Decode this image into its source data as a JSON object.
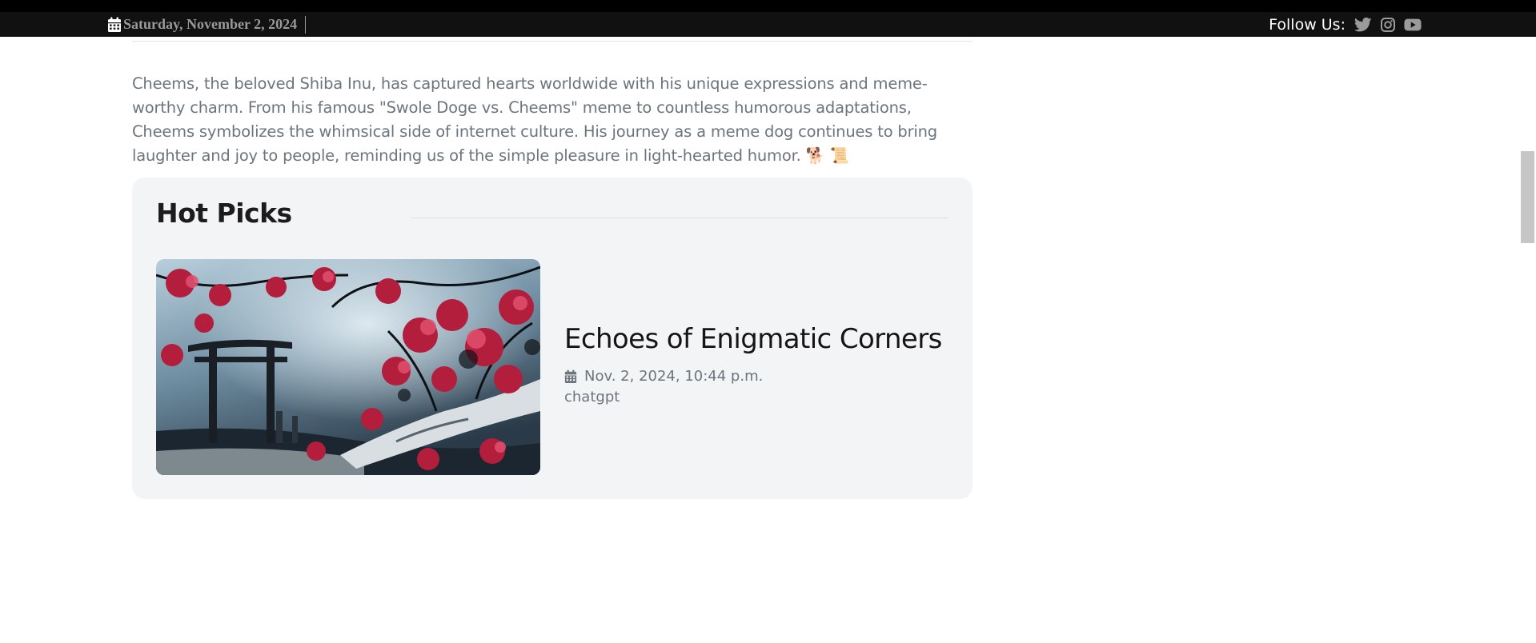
{
  "topbar": {
    "date": "Saturday, November 2, 2024",
    "date_icon": "calendar-icon",
    "follow_label": "Follow Us:",
    "social": [
      {
        "name": "twitter-icon"
      },
      {
        "name": "instagram-icon"
      },
      {
        "name": "youtube-icon"
      }
    ]
  },
  "article": {
    "paragraph": "Cheems, the beloved Shiba Inu, has captured hearts worldwide with his unique expressions and meme-worthy charm. From his famous \"Swole Doge vs. Cheems\" meme to countless humorous adaptations, Cheems symbolizes the whimsical side of internet culture. His journey as a meme dog continues to bring laughter and joy to people, reminding us of the simple pleasure in light-hearted humor. 🐕 📜"
  },
  "hot_picks": {
    "title": "Hot Picks",
    "items": [
      {
        "title": "Echoes of Enigmatic Corners",
        "date": "Nov. 2, 2024, 10:44 p.m.",
        "author": "chatgpt",
        "image": "torii-gate-red-tree-illustration"
      }
    ]
  },
  "colors": {
    "topbar_bg": "#111111",
    "muted_text": "#6c757d",
    "card_bg": "#f3f4f6",
    "heading": "#1c1c1c"
  }
}
